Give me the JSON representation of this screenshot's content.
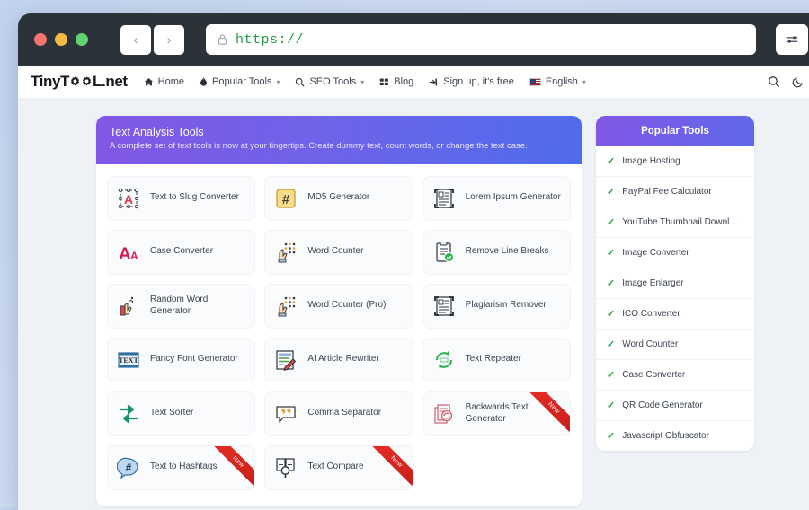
{
  "browser": {
    "back_label": "‹",
    "forward_label": "›",
    "url": "https://",
    "lock_icon": "lock-icon",
    "menu_icon": "sliders-icon"
  },
  "topnav": {
    "logo_part1": "TinyT",
    "logo_part2": "L.net",
    "links": [
      {
        "label": "Home",
        "icon": "home-icon",
        "caret": false
      },
      {
        "label": "Popular Tools",
        "icon": "fire-icon",
        "caret": true
      },
      {
        "label": "SEO Tools",
        "icon": "search-icon",
        "caret": true
      },
      {
        "label": "Blog",
        "icon": "grid-icon",
        "caret": false
      },
      {
        "label": "Sign up, it's free",
        "icon": "signin-icon",
        "caret": false
      },
      {
        "label": "English",
        "icon": "flag-icon",
        "caret": true
      }
    ],
    "search_icon": "search-icon",
    "darkmode_icon": "moon-icon"
  },
  "main": {
    "title": "Text Analysis Tools",
    "subtitle": "A complete set of text tools is now at your fingertips. Create dummy text, count words, or change the text case.",
    "badge_new": "New",
    "tools": [
      {
        "label": "Text to Slug Converter",
        "icon": "text-to-slug-icon",
        "new": false
      },
      {
        "label": "MD5 Generator",
        "icon": "hash-icon",
        "new": false
      },
      {
        "label": "Lorem Ipsum Generator",
        "icon": "document-a-icon",
        "new": false
      },
      {
        "label": "Case Converter",
        "icon": "case-aa-icon",
        "new": false
      },
      {
        "label": "Word Counter",
        "icon": "hand-dots-icon",
        "new": false
      },
      {
        "label": "Remove Line Breaks",
        "icon": "clipboard-check-icon",
        "new": false
      },
      {
        "label": "Random Word Generator",
        "icon": "random-word-icon",
        "new": false
      },
      {
        "label": "Word Counter (Pro)",
        "icon": "hand-dots-icon",
        "new": false
      },
      {
        "label": "Plagiarism Remover",
        "icon": "document-a-icon",
        "new": false
      },
      {
        "label": "Fancy Font Generator",
        "icon": "fancy-text-icon",
        "new": false
      },
      {
        "label": "AI Article Rewriter",
        "icon": "article-pencil-icon",
        "new": false
      },
      {
        "label": "Text Repeater",
        "icon": "repeat-circle-icon",
        "new": false
      },
      {
        "label": "Text Sorter",
        "icon": "sort-arrows-icon",
        "new": false
      },
      {
        "label": "Comma Separator",
        "icon": "comma-bubble-icon",
        "new": false
      },
      {
        "label": "Backwards Text Generator",
        "icon": "backwards-text-icon",
        "new": true
      },
      {
        "label": "Text to Hashtags",
        "icon": "hashtag-bubble-icon",
        "new": true
      },
      {
        "label": "Text Compare",
        "icon": "compare-magnify-icon",
        "new": true
      }
    ]
  },
  "sidebar": {
    "title": "Popular Tools",
    "check_icon": "check-icon",
    "items": [
      {
        "label": "Image Hosting"
      },
      {
        "label": "PayPal Fee Calculator"
      },
      {
        "label": "YouTube Thumbnail Downl…"
      },
      {
        "label": "Image Converter"
      },
      {
        "label": "Image Enlarger"
      },
      {
        "label": "ICO Converter"
      },
      {
        "label": "Word Counter"
      },
      {
        "label": "Case Converter"
      },
      {
        "label": "QR Code Generator"
      },
      {
        "label": "Javascript Obfuscator"
      }
    ]
  },
  "colors": {
    "accent_purple": "#8257e6",
    "accent_blue": "#4f6ced",
    "ribbon_red": "#d42118",
    "check_green": "#22a04a",
    "url_green": "#1f9c43"
  }
}
